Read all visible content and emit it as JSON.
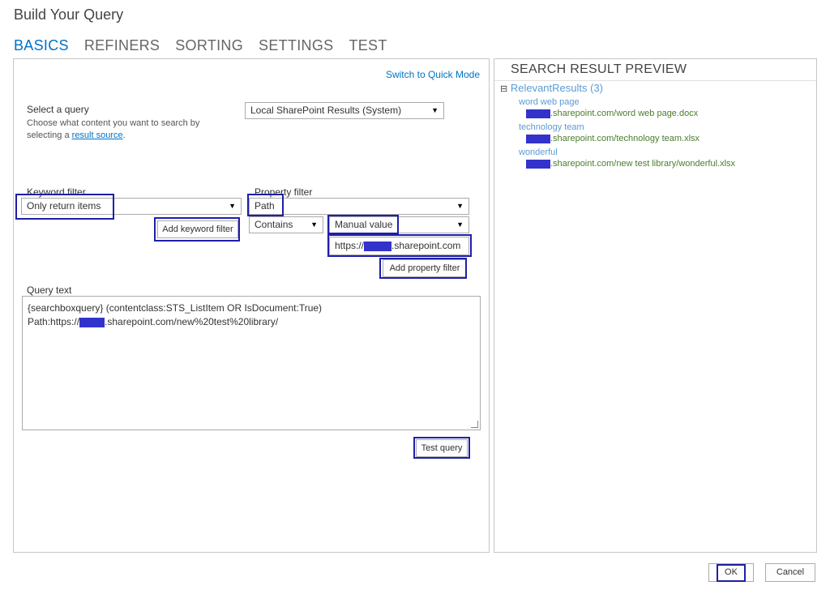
{
  "window": {
    "title": "Build Your Query"
  },
  "tabs": [
    {
      "label": "BASICS",
      "active": true
    },
    {
      "label": "REFINERS"
    },
    {
      "label": "SORTING"
    },
    {
      "label": "SETTINGS"
    },
    {
      "label": "TEST"
    }
  ],
  "basics": {
    "switch_mode": "Switch to Quick Mode",
    "select_query_label": "Select a query",
    "select_query_help": "Choose what content you want to search by selecting a",
    "result_source_link": "result source",
    "period": ".",
    "result_source_value": "Local SharePoint Results (System)",
    "keyword_filter_label": "Keyword filter",
    "keyword_filter_value": "Only return items",
    "add_keyword_filter": "Add keyword filter",
    "property_filter_label": "Property filter",
    "property_value": "Path",
    "operator_value": "Contains",
    "value_type": "Manual value",
    "manual_value_prefix": "https://",
    "manual_value_suffix": ".sharepoint.com",
    "add_property_filter": "Add property filter",
    "query_text_label": "Query text",
    "query_line1": "{searchboxquery} (contentclass:STS_ListItem OR IsDocument:True)",
    "query_line2_prefix": "Path:https://",
    "query_line2_suffix": ".sharepoint.com/new%20test%20library/",
    "test_query": "Test query"
  },
  "preview": {
    "heading": "SEARCH RESULT PREVIEW",
    "group_toggle": "⊟",
    "group_label": "RelevantResults (3)",
    "results": [
      {
        "title": "word web page",
        "url_suffix": ".sharepoint.com/word web page.docx"
      },
      {
        "title": "technology team",
        "url_suffix": ".sharepoint.com/technology team.xlsx"
      },
      {
        "title": "wonderful",
        "url_suffix": ".sharepoint.com/new test library/wonderful.xlsx"
      }
    ]
  },
  "footer": {
    "ok": "OK",
    "cancel": "Cancel"
  },
  "icons": {
    "dropdown": "▼"
  },
  "colors": {
    "accent": "#0072c6",
    "highlight": "#1f1fa8",
    "redaction": "#3333cc",
    "url_green": "#4a7d2c"
  }
}
